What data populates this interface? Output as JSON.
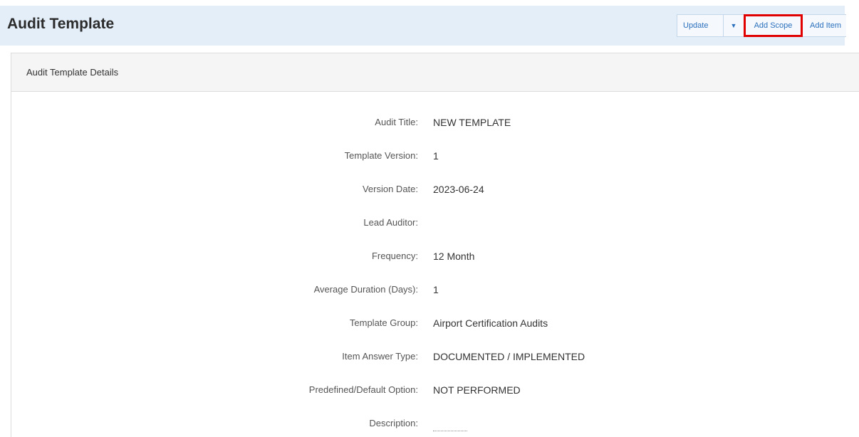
{
  "header": {
    "title": "Audit Template",
    "toolbar": {
      "update_label": "Update",
      "caret": "▼",
      "add_scope_label": "Add Scope",
      "add_item_label": "Add Item"
    }
  },
  "panel": {
    "heading": "Audit Template Details",
    "fields": [
      {
        "label": "Audit Title:",
        "value": "NEW TEMPLATE"
      },
      {
        "label": "Template Version:",
        "value": "1"
      },
      {
        "label": "Version Date:",
        "value": "2023-06-24"
      },
      {
        "label": "Lead Auditor:",
        "value": ""
      },
      {
        "label": "Frequency:",
        "value": "12 Month"
      },
      {
        "label": "Average Duration (Days):",
        "value": "1"
      },
      {
        "label": "Template Group:",
        "value": "Airport Certification Audits"
      },
      {
        "label": "Item Answer Type:",
        "value": "DOCUMENTED / IMPLEMENTED"
      },
      {
        "label": "Predefined/Default Option:",
        "value": "NOT PERFORMED"
      },
      {
        "label": "Description:",
        "value": ""
      }
    ]
  },
  "colors": {
    "header_bg": "#e3eef9",
    "link_blue": "#2a6fbd",
    "highlight_red": "#e00000"
  }
}
